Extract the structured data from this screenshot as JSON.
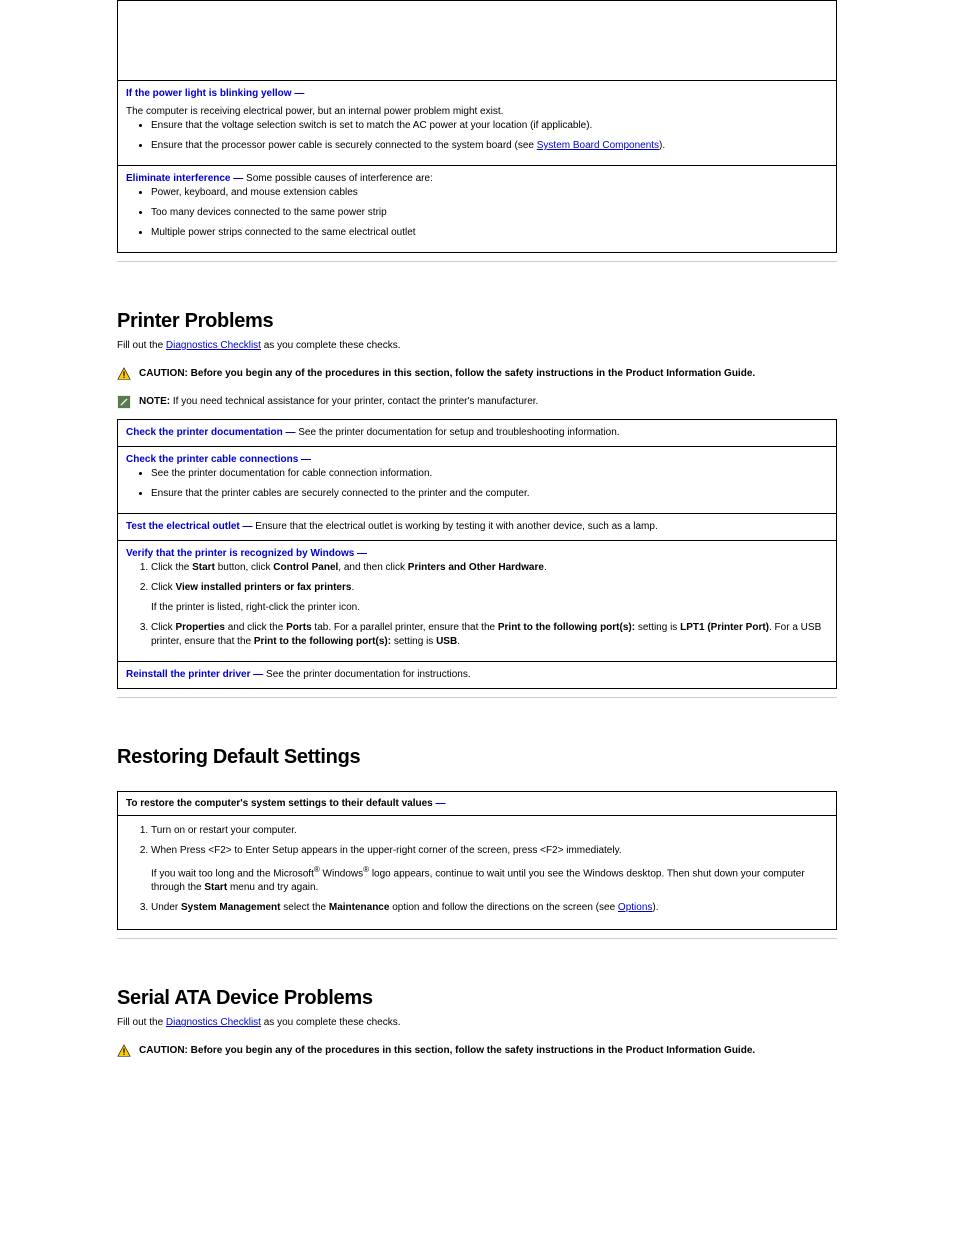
{
  "table_top": {
    "r1_head": "If the power light is blinking yellow  —",
    "r1_body_a": "The computer is receiving electrical power, but an internal power problem might exist.",
    "r1_body_b": "Ensure that the voltage selection switch is set to match the AC power at your location (if applicable).",
    "r1_body_c": "Ensure that the processor power cable is securely connected to the system board (see ",
    "r1_body_c_link": "System Board Components",
    "r1_body_c_tail": ").",
    "r2_head": "Eliminate interference  —",
    "r2_body": "Some possible causes of interference are:",
    "r2_li1": "Power, keyboard, and mouse extension cables",
    "r2_li2": "Too many devices connected to the same power strip",
    "r2_li3": "Multiple power strips connected to the same electrical outlet"
  },
  "printer": {
    "title": "Printer Problems",
    "fill_a": "Fill out the ",
    "fill_link": "Diagnostics Checklist",
    "fill_b": " as you complete these checks.",
    "caution": "CAUTION: Before you begin any of the procedures in this section, follow the safety instructions in the Product Information Guide.",
    "note": "NOTE: If you need technical assistance for your printer, contact the printer's manufacturer.",
    "row1_head": "Check the printer documentation  —",
    "row1_body": "See the printer documentation for setup and troubleshooting information.",
    "row2_head": "Check the printer cable connections  —",
    "row2_li1": "See the printer documentation for cable connection information.",
    "row2_li2": "Ensure that the printer cables are securely connected to the printer and the computer.",
    "row3_head": "Test the electrical outlet  —",
    "row3_body": "Ensure that the electrical outlet is working by testing it with another device, such as a lamp.",
    "row4_head": "Verify that the printer is recognized by Windows  —",
    "row4_ol1_a": "Click the ",
    "row4_ol1_b": "Start",
    "row4_ol1_c": " button, click ",
    "row4_ol1_d": "Control Panel",
    "row4_ol1_e": ", and then click ",
    "row4_ol1_f": "Printers and Other Hardware",
    "row4_ol1_g": ".",
    "row4_ol2_a": "Click ",
    "row4_ol2_b": "View installed printers or fax printers",
    "row4_ol2_c": ".",
    "row4_body2": "If the printer is listed, right-click the printer icon.",
    "row4_ol3_a": "Click ",
    "row4_ol3_b": "Properties",
    "row4_ol3_c": " and click the ",
    "row4_ol3_d": "Ports",
    "row4_ol3_e": " tab. For a parallel printer, ensure that the ",
    "row4_ol3_f": "Print to the following port(s):",
    "row4_ol3_g": " setting is ",
    "row4_ol3_h": "LPT1 (Printer Port)",
    "row4_ol3_i": ". For a USB printer, ensure that the ",
    "row4_ol3_j": "Print to the following port(s):",
    "row4_ol3_k": " setting is ",
    "row4_ol3_l": "USB",
    "row4_ol3_m": ".",
    "row5_head": "Reinstall the printer driver  —",
    "row5_body": "See the printer documentation for instructions."
  },
  "restore": {
    "title": "Restoring Default Settings",
    "box_head_a": "To restore the computer's system settings to their default values ",
    "box_head_dash": "—",
    "li1_a": "Turn on or restart your computer.",
    "li2_a": "When ",
    "li2_b": "Press <F2> to Enter Setup",
    "li2_c": " appears in the upper-right corner of the screen, press <F2> immediately.",
    "li2_p_a": "If you wait too long and the Microsoft",
    "li2_p_b": " Windows",
    "li2_p_c": " logo appears, continue to wait until you see the Windows desktop. Then shut down your computer through the ",
    "li2_p_d": "Start",
    "li2_p_e": " menu and try again.",
    "li3_a": "Under ",
    "li3_b": "System Management",
    "li3_c": " select the ",
    "li3_d": "Maintenance",
    "li3_e": " option and follow the directions on the screen (see ",
    "li3_link": "Options",
    "li3_g": ")."
  },
  "sas": {
    "title": "Serial ATA Device Problems ",
    "fill_a": "Fill out the ",
    "fill_link": "Diagnostics Checklist",
    "fill_b": " as you complete these checks.",
    "caution": "CAUTION: Before you begin any of the procedures in this section, follow the safety instructions in the Product Information Guide."
  }
}
